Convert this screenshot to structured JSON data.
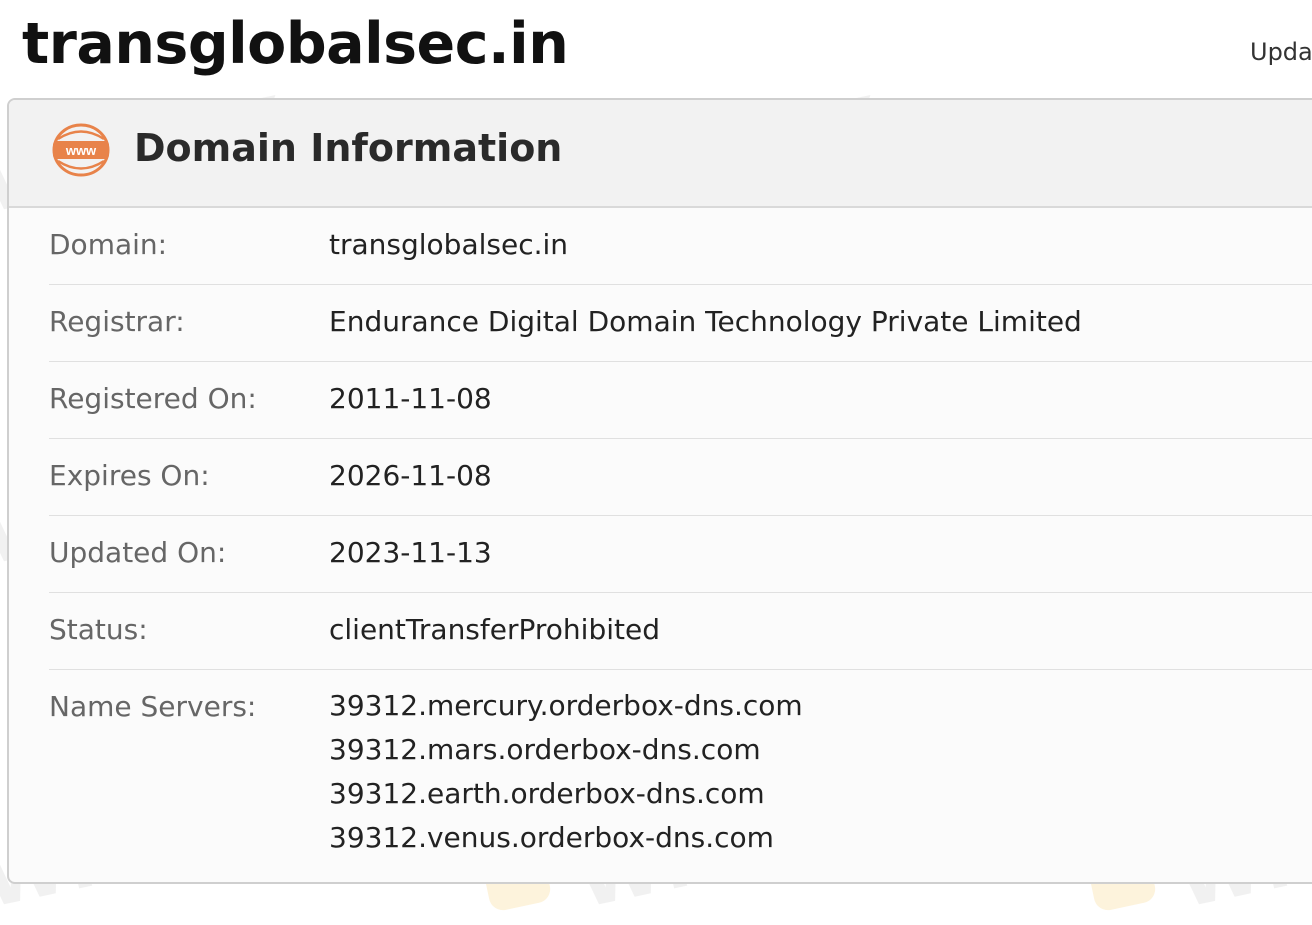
{
  "page": {
    "title": "transglobalsec.in",
    "updated_corner": "Upda"
  },
  "panel": {
    "title": "Domain Information",
    "icon": "www-icon",
    "rows": [
      {
        "label": "Domain:",
        "value": "transglobalsec.in"
      },
      {
        "label": "Registrar:",
        "value": "Endurance Digital Domain Technology Private Limited"
      },
      {
        "label": "Registered On:",
        "value": "2011-11-08"
      },
      {
        "label": "Expires On:",
        "value": "2026-11-08"
      },
      {
        "label": "Updated On:",
        "value": "2023-11-13"
      },
      {
        "label": "Status:",
        "value": "clientTransferProhibited"
      }
    ],
    "name_servers": {
      "label": "Name Servers:",
      "values": [
        "39312.mercury.orderbox-dns.com",
        "39312.mars.orderbox-dns.com",
        "39312.earth.orderbox-dns.com",
        "39312.venus.orderbox-dns.com"
      ]
    }
  },
  "watermark": {
    "text": "WikiFX"
  },
  "colors": {
    "icon_orange": "#e8834a",
    "header_bg": "#f2f2f2"
  }
}
